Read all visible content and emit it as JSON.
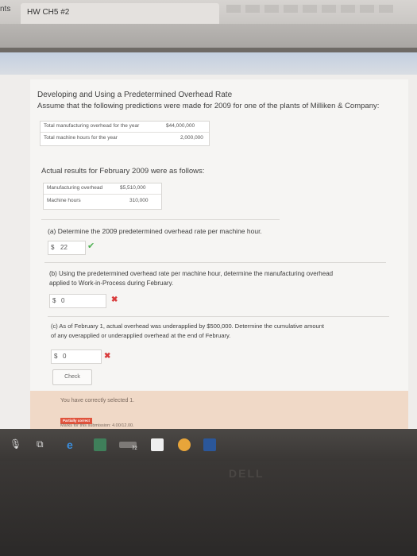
{
  "browser": {
    "tab_left_label": "nts",
    "tab_title": "HW CH5 #2"
  },
  "problem": {
    "title": "Developing and Using a Predetermined Overhead Rate",
    "intro": "Assume that the following predictions were made for 2009 for one of the plants of Milliken & Company:",
    "predictions": [
      {
        "label": "Total manufacturing overhead for the year",
        "value": "$44,000,000"
      },
      {
        "label": "Total machine hours for the year",
        "value": "2,000,000"
      }
    ],
    "actual_intro": "Actual results for February 2009 were as follows:",
    "actuals": [
      {
        "label": "Manufacturing overhead",
        "value": "$5,510,000"
      },
      {
        "label": "Machine hours",
        "value": "310,000"
      }
    ]
  },
  "questions": {
    "a": {
      "text": "(a) Determine the 2009 predetermined overhead rate per machine hour.",
      "currency": "$",
      "answer": "22",
      "status": "correct"
    },
    "b": {
      "line1": "(b) Using the predetermined overhead rate per machine hour, determine the manufacturing overhead",
      "line2": "applied to Work-in-Process during February.",
      "currency": "$",
      "answer": "0",
      "status": "incorrect"
    },
    "c": {
      "line1": "(c) As of February 1, actual overhead was underapplied by $500,000. Determine the cumulative amount",
      "line2": "of any overapplied or underapplied overhead at the end of February.",
      "currency": "$",
      "answer": "0",
      "status": "incorrect"
    }
  },
  "check_button_label": "Check",
  "feedback": {
    "message": "You have correctly selected 1.",
    "badge": "Partially correct",
    "marks": "Marks for this submission: 4.00/12.00."
  },
  "taskbar": {
    "badge_count": "72"
  },
  "bezel_brand": "DELL",
  "colors": {
    "correct": "#4caf50",
    "incorrect": "#d93b3b",
    "feedback_bg": "#f0d9c7",
    "badge_bg": "#e0533c"
  }
}
